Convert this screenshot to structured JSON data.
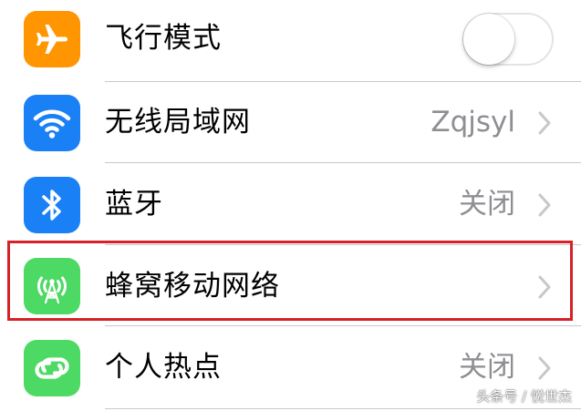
{
  "colors": {
    "airplane_icon_bg": "#ff9500",
    "wifi_icon_bg": "#1a80f5",
    "bluetooth_icon_bg": "#1a80f5",
    "cellular_icon_bg": "#4cd964",
    "hotspot_icon_bg": "#4cd964",
    "highlight_border": "#d62127",
    "detail_text": "#8e8e93"
  },
  "settings": {
    "airplane_mode": {
      "label": "飞行模式",
      "icon": "airplane-icon",
      "toggle_on": false
    },
    "wifi": {
      "label": "无线局域网",
      "icon": "wifi-icon",
      "value": "Zqjsyl"
    },
    "bluetooth": {
      "label": "蓝牙",
      "icon": "bluetooth-icon",
      "value": "关闭"
    },
    "cellular": {
      "label": "蜂窝移动网络",
      "icon": "cellular-antenna-icon",
      "highlighted": true
    },
    "hotspot": {
      "label": "个人热点",
      "icon": "hotspot-link-icon",
      "value": "关闭"
    }
  },
  "watermark": "头条号 / 悦世杰"
}
